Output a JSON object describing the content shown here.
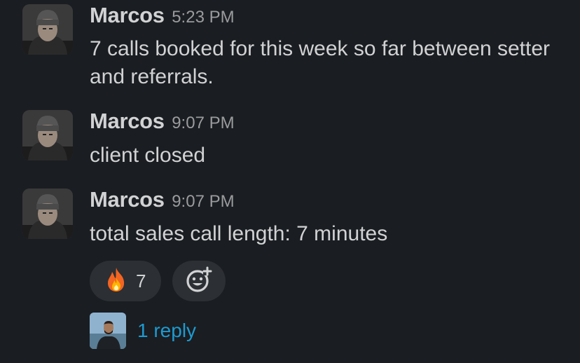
{
  "messages": [
    {
      "author": "Marcos",
      "time": "5:23 PM",
      "text": "7 calls booked for this week so far between setter and referrals."
    },
    {
      "author": "Marcos",
      "time": "9:07 PM",
      "text": "client closed"
    },
    {
      "author": "Marcos",
      "time": "9:07 PM",
      "text": "total sales call length: 7 minutes"
    }
  ],
  "reactions": [
    {
      "icon": "fire-emoji-icon",
      "count": "7"
    },
    {
      "icon": "add-reaction-icon"
    }
  ],
  "thread": {
    "reply_label": "1 reply"
  },
  "colors": {
    "background": "#1a1d21",
    "author": "#d1d2d3",
    "timestamp": "#9a9b9d",
    "link": "#1d9bd1",
    "reaction_pill": "#2c2f33"
  }
}
